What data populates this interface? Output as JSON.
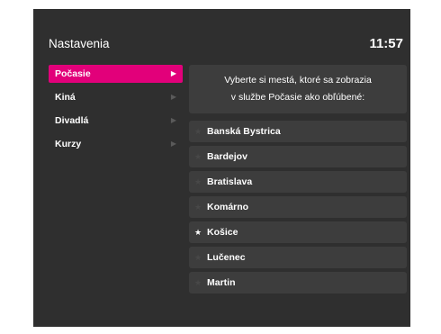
{
  "header": {
    "title": "Nastavenia",
    "time": "11:57"
  },
  "menu": {
    "items": [
      {
        "label": "Počasie",
        "active": true
      },
      {
        "label": "Kiná",
        "active": false
      },
      {
        "label": "Divadlá",
        "active": false
      },
      {
        "label": "Kurzy",
        "active": false
      }
    ],
    "arrow_icon": "arrow-right-icon"
  },
  "info": {
    "line1": "Vyberte si mestá, ktoré sa zobrazia",
    "line2": "v službe Počasie ako obľúbené:"
  },
  "cities": [
    {
      "name": "Banská Bystrica",
      "favorite": false
    },
    {
      "name": "Bardejov",
      "favorite": false
    },
    {
      "name": "Bratislava",
      "favorite": false
    },
    {
      "name": "Komárno",
      "favorite": false
    },
    {
      "name": "Košice",
      "favorite": true
    },
    {
      "name": "Lučenec",
      "favorite": false
    },
    {
      "name": "Martin",
      "favorite": false
    }
  ],
  "colors": {
    "accent": "#e2007a",
    "background": "#2f2f2f",
    "panel": "#3d3d3d"
  }
}
